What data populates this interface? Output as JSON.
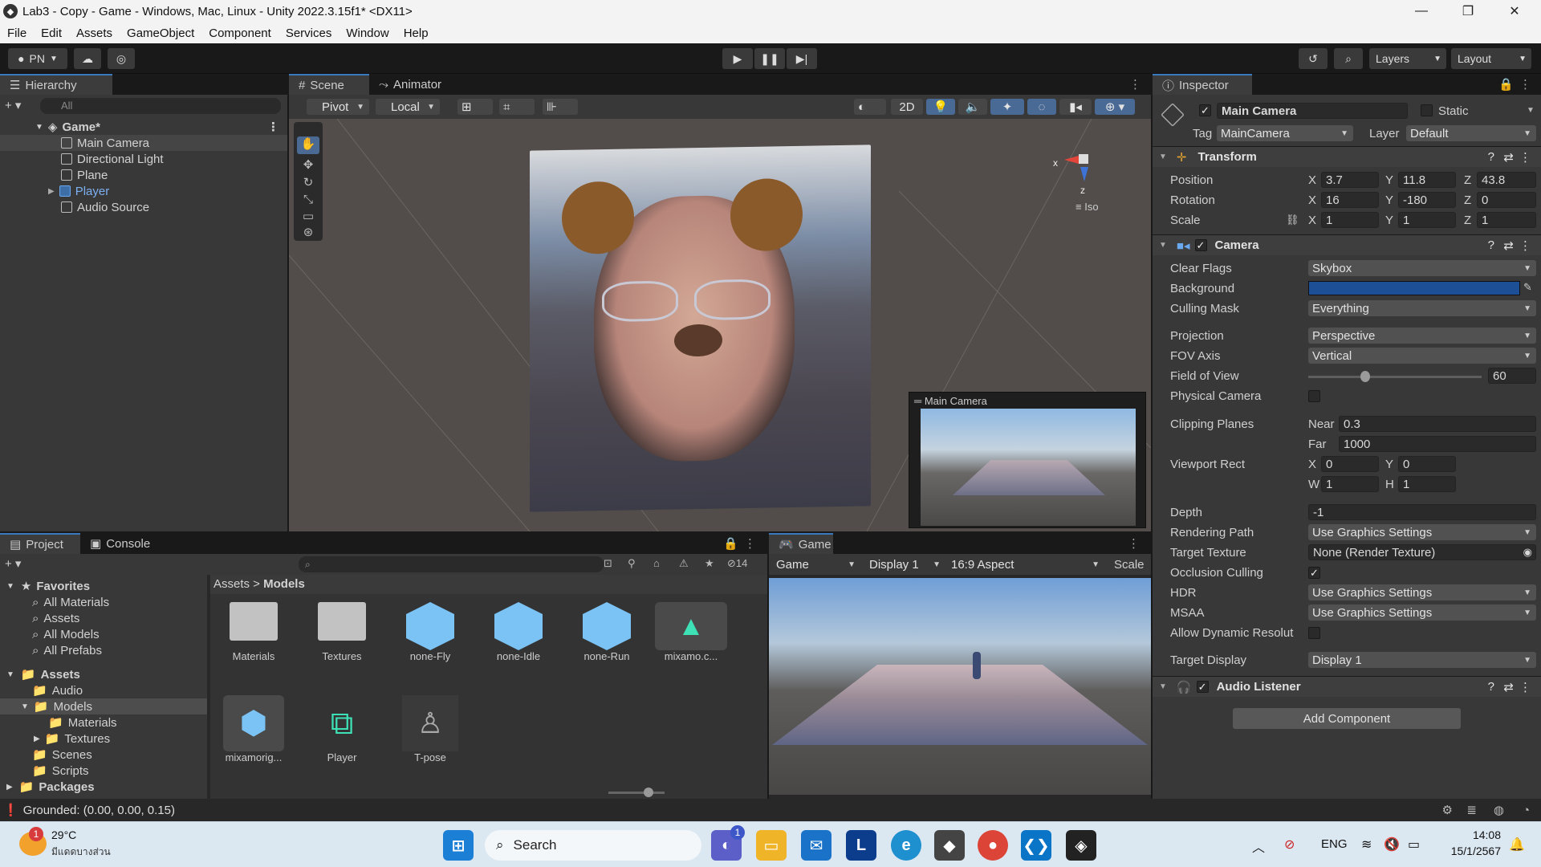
{
  "window": {
    "title": "Lab3 - Copy - Game - Windows, Mac, Linux - Unity 2022.3.15f1* <DX11>"
  },
  "menu": [
    "File",
    "Edit",
    "Assets",
    "GameObject",
    "Component",
    "Services",
    "Window",
    "Help"
  ],
  "toolbar": {
    "account": "PN",
    "layers": "Layers",
    "layout": "Layout"
  },
  "hierarchy": {
    "tab": "Hierarchy",
    "search_placeholder": "All",
    "scene": "Game*",
    "items": [
      "Main Camera",
      "Directional Light",
      "Plane",
      "Player",
      "Audio Source"
    ]
  },
  "scene_view": {
    "tabs": [
      "Scene",
      "Animator"
    ],
    "pivot": "Pivot",
    "local": "Local",
    "mode_2d": "2D",
    "gizmo_x": "x",
    "gizmo_z": "z",
    "iso": "Iso",
    "camera_preview_title": "Main Camera"
  },
  "inspector": {
    "tab": "Inspector",
    "object_name": "Main Camera",
    "static_label": "Static",
    "tag_label": "Tag",
    "tag_value": "MainCamera",
    "layer_label": "Layer",
    "layer_value": "Default",
    "transform": {
      "title": "Transform",
      "position": {
        "label": "Position",
        "x": "3.7",
        "y": "11.8",
        "z": "43.8"
      },
      "rotation": {
        "label": "Rotation",
        "x": "16",
        "y": "-180",
        "z": "0"
      },
      "scale": {
        "label": "Scale",
        "x": "1",
        "y": "1",
        "z": "1"
      }
    },
    "camera": {
      "title": "Camera",
      "clear_flags": {
        "label": "Clear Flags",
        "value": "Skybox"
      },
      "background": {
        "label": "Background",
        "color": "#1d4f96"
      },
      "culling_mask": {
        "label": "Culling Mask",
        "value": "Everything"
      },
      "projection": {
        "label": "Projection",
        "value": "Perspective"
      },
      "fov_axis": {
        "label": "FOV Axis",
        "value": "Vertical"
      },
      "field_of_view": {
        "label": "Field of View",
        "value": "60",
        "fraction": 0.33
      },
      "physical_camera": {
        "label": "Physical Camera"
      },
      "clipping_planes": {
        "label": "Clipping Planes",
        "near_label": "Near",
        "near": "0.3",
        "far_label": "Far",
        "far": "1000"
      },
      "viewport_rect": {
        "label": "Viewport Rect",
        "x": "0",
        "y": "0",
        "w": "1",
        "h": "1"
      },
      "depth": {
        "label": "Depth",
        "value": "-1"
      },
      "rendering_path": {
        "label": "Rendering Path",
        "value": "Use Graphics Settings"
      },
      "target_texture": {
        "label": "Target Texture",
        "value": "None (Render Texture)"
      },
      "occlusion_culling": {
        "label": "Occlusion Culling"
      },
      "hdr": {
        "label": "HDR",
        "value": "Use Graphics Settings"
      },
      "msaa": {
        "label": "MSAA",
        "value": "Use Graphics Settings"
      },
      "allow_dynamic": {
        "label": "Allow Dynamic Resolut"
      },
      "target_display": {
        "label": "Target Display",
        "value": "Display 1"
      }
    },
    "audio_listener": {
      "title": "Audio Listener"
    },
    "add_component": "Add Component"
  },
  "project": {
    "tabs": [
      "Project",
      "Console"
    ],
    "hidden_count": "14",
    "favorites": {
      "title": "Favorites",
      "items": [
        "All Materials",
        "Assets",
        "All Models",
        "All Prefabs"
      ]
    },
    "assets_tree": {
      "title": "Assets",
      "items": [
        "Audio",
        "Models",
        "Materials",
        "Textures",
        "Scenes",
        "Scripts"
      ]
    },
    "packages": "Packages",
    "breadcrumb": [
      "Assets",
      "Models"
    ],
    "grid": [
      "Materials",
      "Textures",
      "none-Fly",
      "none-Idle",
      "none-Run",
      "mixamo.c...",
      "mixamorig...",
      "Player",
      "T-pose"
    ]
  },
  "game": {
    "tab": "Game",
    "mode": "Game",
    "display": "Display 1",
    "aspect": "16:9 Aspect",
    "scale": "Scale"
  },
  "status": {
    "text": "Grounded: (0.00, 0.00, 0.15)"
  },
  "taskbar": {
    "weather_temp": "29°C",
    "weather_desc": "มีแดดบางส่วน",
    "weather_badge": "1",
    "search": "Search",
    "teams_badge": "1",
    "lang": "ENG",
    "time": "14:08",
    "date": "15/1/2567"
  }
}
